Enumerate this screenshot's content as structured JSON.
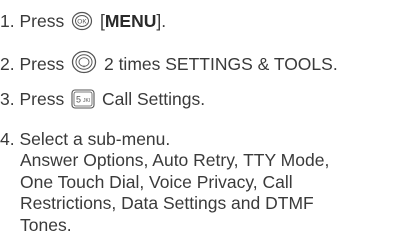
{
  "steps": [
    {
      "number": "1.",
      "before": "Press",
      "key_icon": "ok-key-icon",
      "after_open": "[",
      "bold": "MENU",
      "after_close": "]."
    },
    {
      "number": "2.",
      "before": "Press",
      "key_icon": "navigation-key-icon",
      "after": "2 times SETTINGS & TOOLS."
    },
    {
      "number": "3.",
      "before": "Press",
      "key_icon": "5-jkl-key-icon",
      "key_label": "5 JKl",
      "after": "Call Settings."
    },
    {
      "number": "4.",
      "text": "Select a sub-menu.",
      "sub_lines": [
        "Answer Options, Auto Retry, TTY Mode,",
        "One Touch Dial, Voice Privacy, Call",
        "Restrictions, Data Settings and DTMF",
        "Tones."
      ]
    }
  ],
  "colors": {
    "text": "#3a3a3a",
    "icon": "#555555"
  }
}
